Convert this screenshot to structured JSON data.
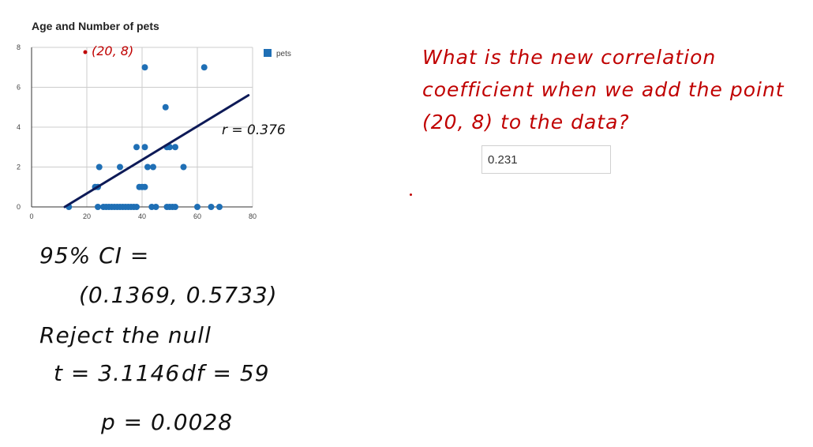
{
  "chart_data": {
    "type": "scatter",
    "title": "Age and Number of pets",
    "xlim": [
      0,
      80
    ],
    "ylim": [
      0,
      8
    ],
    "x_ticks": [
      "0",
      "20",
      "40",
      "60",
      "80"
    ],
    "y_ticks": [
      "0",
      "2",
      "4",
      "6",
      "8"
    ],
    "grid": true,
    "legend": {
      "position": "top-right",
      "entries": [
        "pets"
      ]
    },
    "series": [
      {
        "name": "pets",
        "color": "#1f6fb5",
        "points": [
          [
            13.5,
            0
          ],
          [
            24,
            0
          ],
          [
            26,
            0
          ],
          [
            27,
            0
          ],
          [
            28,
            0
          ],
          [
            29,
            0
          ],
          [
            30,
            0
          ],
          [
            31,
            0
          ],
          [
            32,
            0
          ],
          [
            33,
            0
          ],
          [
            34,
            0
          ],
          [
            35,
            0
          ],
          [
            36,
            0
          ],
          [
            37,
            0
          ],
          [
            38,
            0
          ],
          [
            43.5,
            0
          ],
          [
            45,
            0
          ],
          [
            49,
            0
          ],
          [
            50,
            0
          ],
          [
            51,
            0
          ],
          [
            52,
            0
          ],
          [
            60,
            0
          ],
          [
            65,
            0
          ],
          [
            68,
            0
          ],
          [
            23,
            1
          ],
          [
            24,
            1
          ],
          [
            39,
            1
          ],
          [
            40,
            1
          ],
          [
            41,
            1
          ],
          [
            24.5,
            2
          ],
          [
            32,
            2
          ],
          [
            42,
            2
          ],
          [
            44,
            2
          ],
          [
            55,
            2
          ],
          [
            38,
            3
          ],
          [
            41,
            3
          ],
          [
            49,
            3
          ],
          [
            50,
            3
          ],
          [
            52,
            3
          ],
          [
            48.5,
            5
          ],
          [
            41,
            7
          ],
          [
            62.5,
            7
          ]
        ]
      }
    ],
    "trendline": {
      "color": "#0d1a57",
      "points": [
        [
          12,
          0
        ],
        [
          78.5,
          5.6
        ]
      ]
    },
    "annotations": {
      "added_point": {
        "x": 20,
        "y": 8,
        "label": "(20, 8)",
        "color": "#c00000"
      },
      "r_label": "r = 0.376"
    }
  },
  "question": {
    "text": "What is the new correlation coefficient when we add the point (20, 8) to the data?",
    "answer_value": "0.231"
  },
  "notes": {
    "ci_label": "95% CI =",
    "ci_value": "(0.1369, 0.5733)",
    "reject": "Reject the null",
    "t": "t = 3.1146",
    "df": "df = 59",
    "p": "p = 0.0028"
  }
}
